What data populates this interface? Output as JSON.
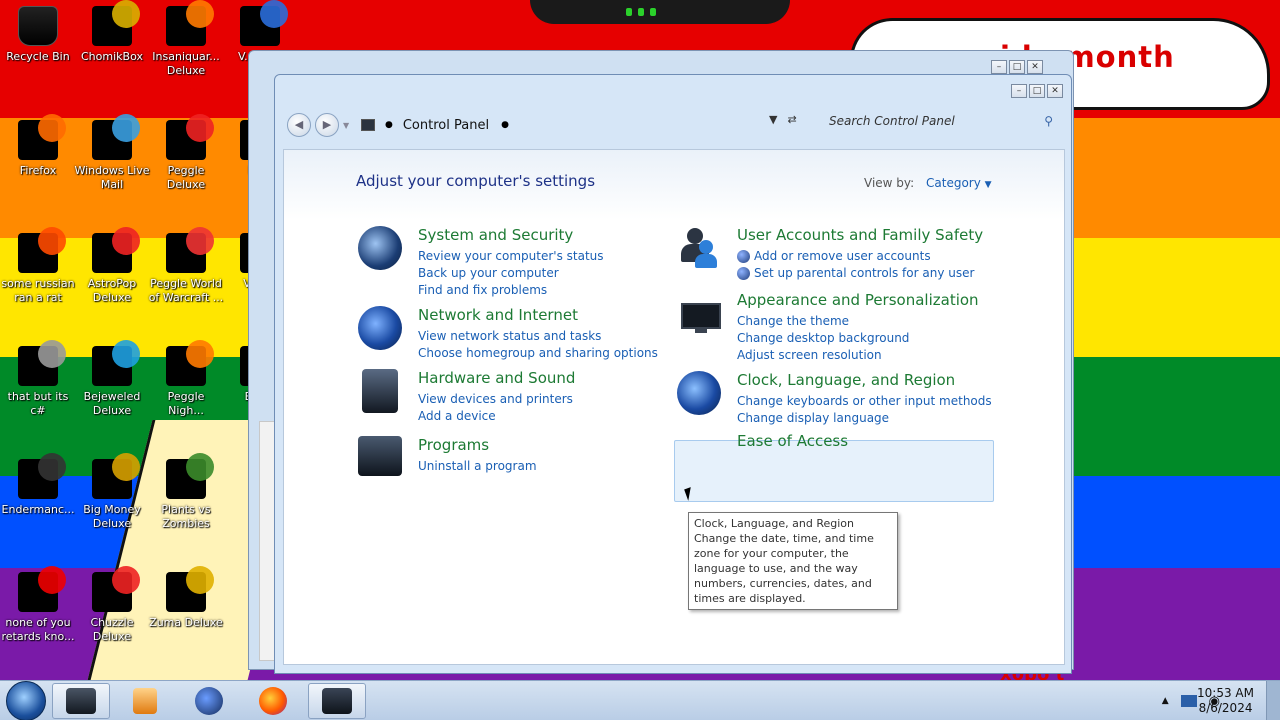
{
  "wallpaper": {
    "banner_text": "ide month",
    "bottom_text": "x0bo t"
  },
  "desktop_icons": [
    {
      "label": "Recycle Bin"
    },
    {
      "label": "ChomikBox"
    },
    {
      "label": "Insaniquar... Deluxe"
    },
    {
      "label": "V... Ke..."
    },
    {
      "label": "Firefox"
    },
    {
      "label": "Windows Live Mail"
    },
    {
      "label": "Peggle Deluxe"
    },
    {
      "label": "Ke..."
    },
    {
      "label": "some russian ran a rat"
    },
    {
      "label": "AstroPop Deluxe"
    },
    {
      "label": "Peggle World of Warcraft ..."
    },
    {
      "label": "Visu..."
    },
    {
      "label": "that but its c#"
    },
    {
      "label": "Bejeweled Deluxe"
    },
    {
      "label": "Peggle Nigh..."
    },
    {
      "label": "Eve..."
    },
    {
      "label": "Endermanc..."
    },
    {
      "label": "Big Money Deluxe"
    },
    {
      "label": "Plants vs Zombies"
    },
    {
      "label": "none of you retards kno..."
    },
    {
      "label": "Chuzzle Deluxe"
    },
    {
      "label": "Zuma Deluxe"
    }
  ],
  "window": {
    "back_glyph": "◀",
    "forward_glyph": "▶",
    "minimize_glyph": "–",
    "maximize_glyph": "□",
    "close_glyph": "✕",
    "breadcrumb": "Control Panel",
    "search_placeholder": "Search Control Panel",
    "heading": "Adjust your computer's settings",
    "view_by_label": "View by:",
    "view_by_value": "Category"
  },
  "categories_left": [
    {
      "title": "System and Security",
      "links": [
        "Review your computer's status",
        "Back up your computer",
        "Find and fix problems"
      ]
    },
    {
      "title": "Network and Internet",
      "links": [
        "View network status and tasks",
        "Choose homegroup and sharing options"
      ]
    },
    {
      "title": "Hardware and Sound",
      "links": [
        "View devices and printers",
        "Add a device"
      ]
    },
    {
      "title": "Programs",
      "links": [
        "Uninstall a program"
      ]
    }
  ],
  "categories_right": [
    {
      "title": "User Accounts and Family Safety",
      "links": [
        "Add or remove user accounts",
        "Set up parental controls for any user"
      ]
    },
    {
      "title": "Appearance and Personalization",
      "links": [
        "Change the theme",
        "Change desktop background",
        "Adjust screen resolution"
      ]
    },
    {
      "title": "Clock, Language, and Region",
      "links": [
        "Change keyboards or other input methods",
        "Change display language"
      ]
    },
    {
      "title": "Ease of Access",
      "links": []
    }
  ],
  "tooltip": {
    "title": "Clock, Language, and Region",
    "body": "Change the date, time, and time zone for your computer, the language to use, and the way numbers, currencies, dates, and times are displayed."
  },
  "taskbar": {
    "time": "10:53 AM",
    "date": "8/6/2024"
  },
  "colors": {
    "link": "#1a5fb4",
    "category_title": "#1d7a34",
    "heading": "#1e3287"
  }
}
